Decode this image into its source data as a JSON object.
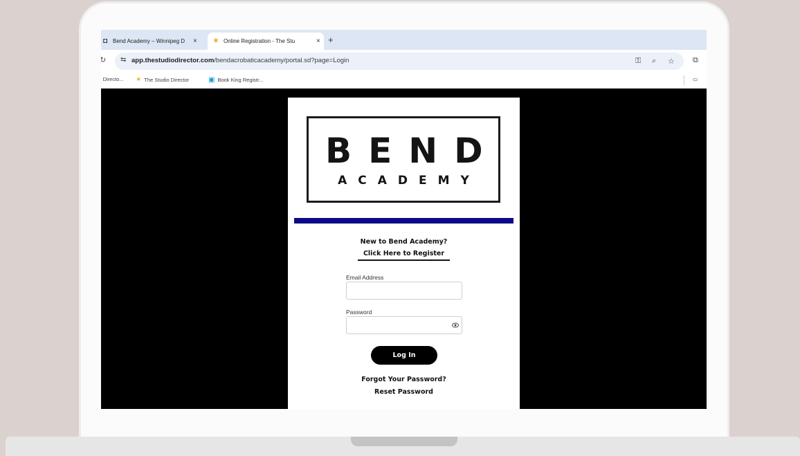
{
  "browser": {
    "tabs": [
      {
        "title": "Bend Academy – Winnipeg D",
        "favicon": "github-style-icon",
        "active": false
      },
      {
        "title": "Online Registration - The Stu",
        "favicon": "studio-director-icon",
        "active": true
      }
    ],
    "new_tab_label": "+",
    "close_label": "×",
    "url_host": "app.thestudiodirector.com",
    "url_path": "/bendacrobaticacademy/portal.sd?page=Login",
    "bookmarks": [
      {
        "label": "› Directo...",
        "icon": "truncated"
      },
      {
        "label": "The Studio Director",
        "icon": "studio-director-icon"
      },
      {
        "label": "Book King Registr...",
        "icon": "book-icon"
      }
    ]
  },
  "page": {
    "logo_main": "BEND",
    "logo_sub": "ACADEMY",
    "new_heading": "New to Bend Academy?",
    "register_link": "Click Here to Register",
    "email_label": "Email Address",
    "email_value": "",
    "password_label": "Password",
    "password_value": "",
    "login_button": "Log In",
    "forgot_text": "Forgot Your Password?",
    "reset_link": "Reset Password"
  },
  "colors": {
    "accent_bar": "#0a0a8a",
    "background": "#dbd1ce"
  }
}
